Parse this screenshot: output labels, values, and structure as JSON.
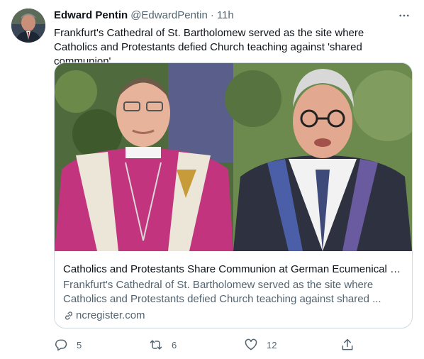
{
  "author": {
    "name": "Edward Pentin",
    "handle": "@EdwardPentin",
    "separator": "·",
    "time": "11h"
  },
  "tweet": {
    "text": "Frankfurt's Cathedral of St. Bartholomew served as the site where Catholics and Protestants defied Church teaching against 'shared communion'."
  },
  "card": {
    "title": "Catholics and Protestants Share Communion at German Ecumenical Co...",
    "description": "Frankfurt's Cathedral of St. Bartholomew served as the site where Catholics and Protestants defied Church teaching against shared ...",
    "domain": "ncregister.com"
  },
  "actions": {
    "replies": "5",
    "retweets": "6",
    "likes": "12"
  },
  "icons": {
    "more": "more-horizontal-icon",
    "reply": "reply-icon",
    "retweet": "retweet-icon",
    "like": "heart-icon",
    "share": "share-icon",
    "link": "link-icon"
  },
  "colors": {
    "text_primary": "#0f1419",
    "text_secondary": "#536471",
    "border": "#cfd9de"
  }
}
